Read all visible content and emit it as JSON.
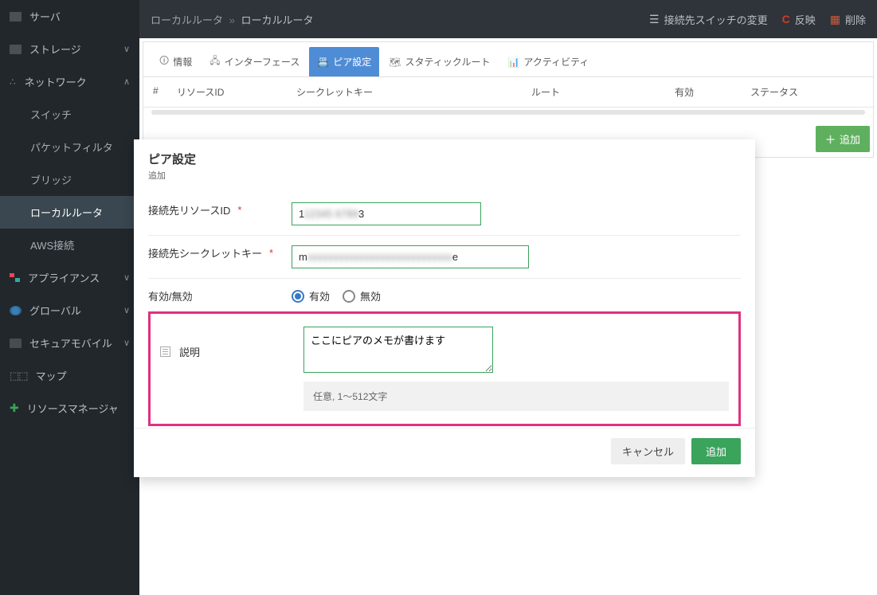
{
  "sidebar": {
    "items": [
      {
        "label": "サーバ"
      },
      {
        "label": "ストレージ"
      },
      {
        "label": "ネットワーク"
      },
      {
        "label": "アプライアンス"
      },
      {
        "label": "グローバル"
      },
      {
        "label": "セキュアモバイル"
      },
      {
        "label": "マップ"
      },
      {
        "label": "リソースマネージャ"
      }
    ],
    "network_sub": [
      {
        "label": "スイッチ"
      },
      {
        "label": "パケットフィルタ"
      },
      {
        "label": "ブリッジ"
      },
      {
        "label": "ローカルルータ"
      },
      {
        "label": "AWS接続"
      }
    ]
  },
  "topbar": {
    "crumb1": "ローカルルータ",
    "crumb2": "ローカルルータ",
    "switch_change": "接続先スイッチの変更",
    "reflect": "反映",
    "delete": "削除"
  },
  "tabs": {
    "info": "情報",
    "iface": "インターフェース",
    "peer": "ピア設定",
    "static": "スタティックルート",
    "activity": "アクティビティ"
  },
  "table": {
    "h1": "#",
    "h2": "リソースID",
    "h3": "シークレットキー",
    "h4": "ルート",
    "h5": "有効",
    "h6": "ステータス"
  },
  "add_button": "追加",
  "modal": {
    "title": "ピア設定",
    "subtitle": "追加",
    "resource_label": "接続先リソースID",
    "resource_value_start": "1",
    "resource_value_mid": "12345 6789",
    "resource_value_end": "3",
    "secret_label": "接続先シークレットキー",
    "secret_start": "m",
    "secret_mid": "xxxxxxxxxxxxxxxxxxxxxxxxxxxx",
    "secret_end": "e",
    "enable_label": "有効/無効",
    "enable_on": "有効",
    "enable_off": "無効",
    "desc_label": "説明",
    "desc_value": "ここにピアのメモが書けます",
    "desc_help": "任意, 1〜512文字",
    "cancel": "キャンセル",
    "submit": "追加"
  }
}
